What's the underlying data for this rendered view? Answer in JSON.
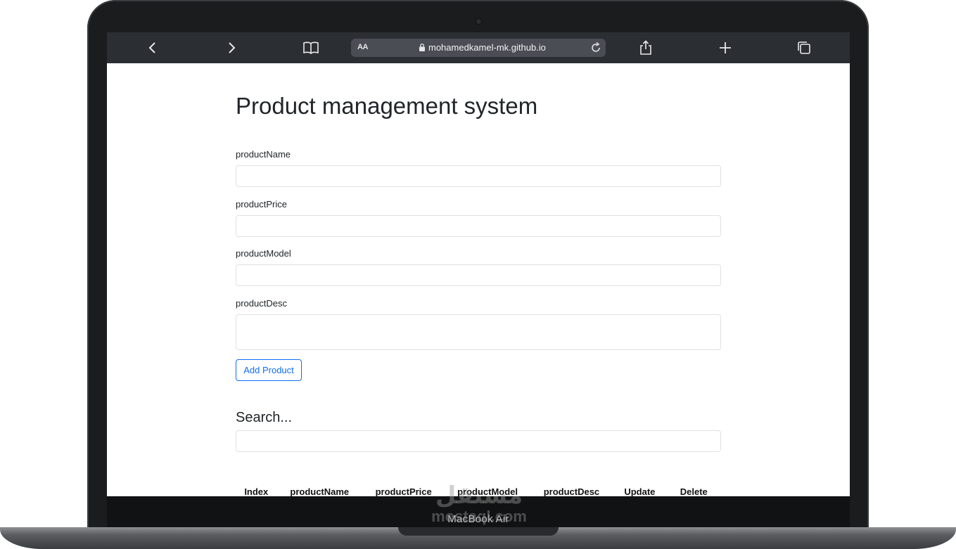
{
  "device": {
    "model_label": "MacBook Air"
  },
  "browser": {
    "url_aa": "AA",
    "url": "mohamedkamel-mk.github.io"
  },
  "page": {
    "title": "Product management system",
    "form": {
      "fields": [
        {
          "label": "productName",
          "value": ""
        },
        {
          "label": "productPrice",
          "value": ""
        },
        {
          "label": "productModel",
          "value": ""
        },
        {
          "label": "productDesc",
          "value": ""
        }
      ],
      "add_button": "Add Product"
    },
    "search": {
      "heading": "Search...",
      "value": ""
    },
    "table": {
      "headers": [
        "Index",
        "productName",
        "productPrice",
        "productModel",
        "productDesc",
        "Update",
        "Delete"
      ]
    }
  },
  "watermark": {
    "line1": "مستقل",
    "line2": "mostaql.com"
  },
  "colors": {
    "toolbar_bg": "#2b2e33",
    "accent": "#0d6efd",
    "text": "#212529"
  }
}
